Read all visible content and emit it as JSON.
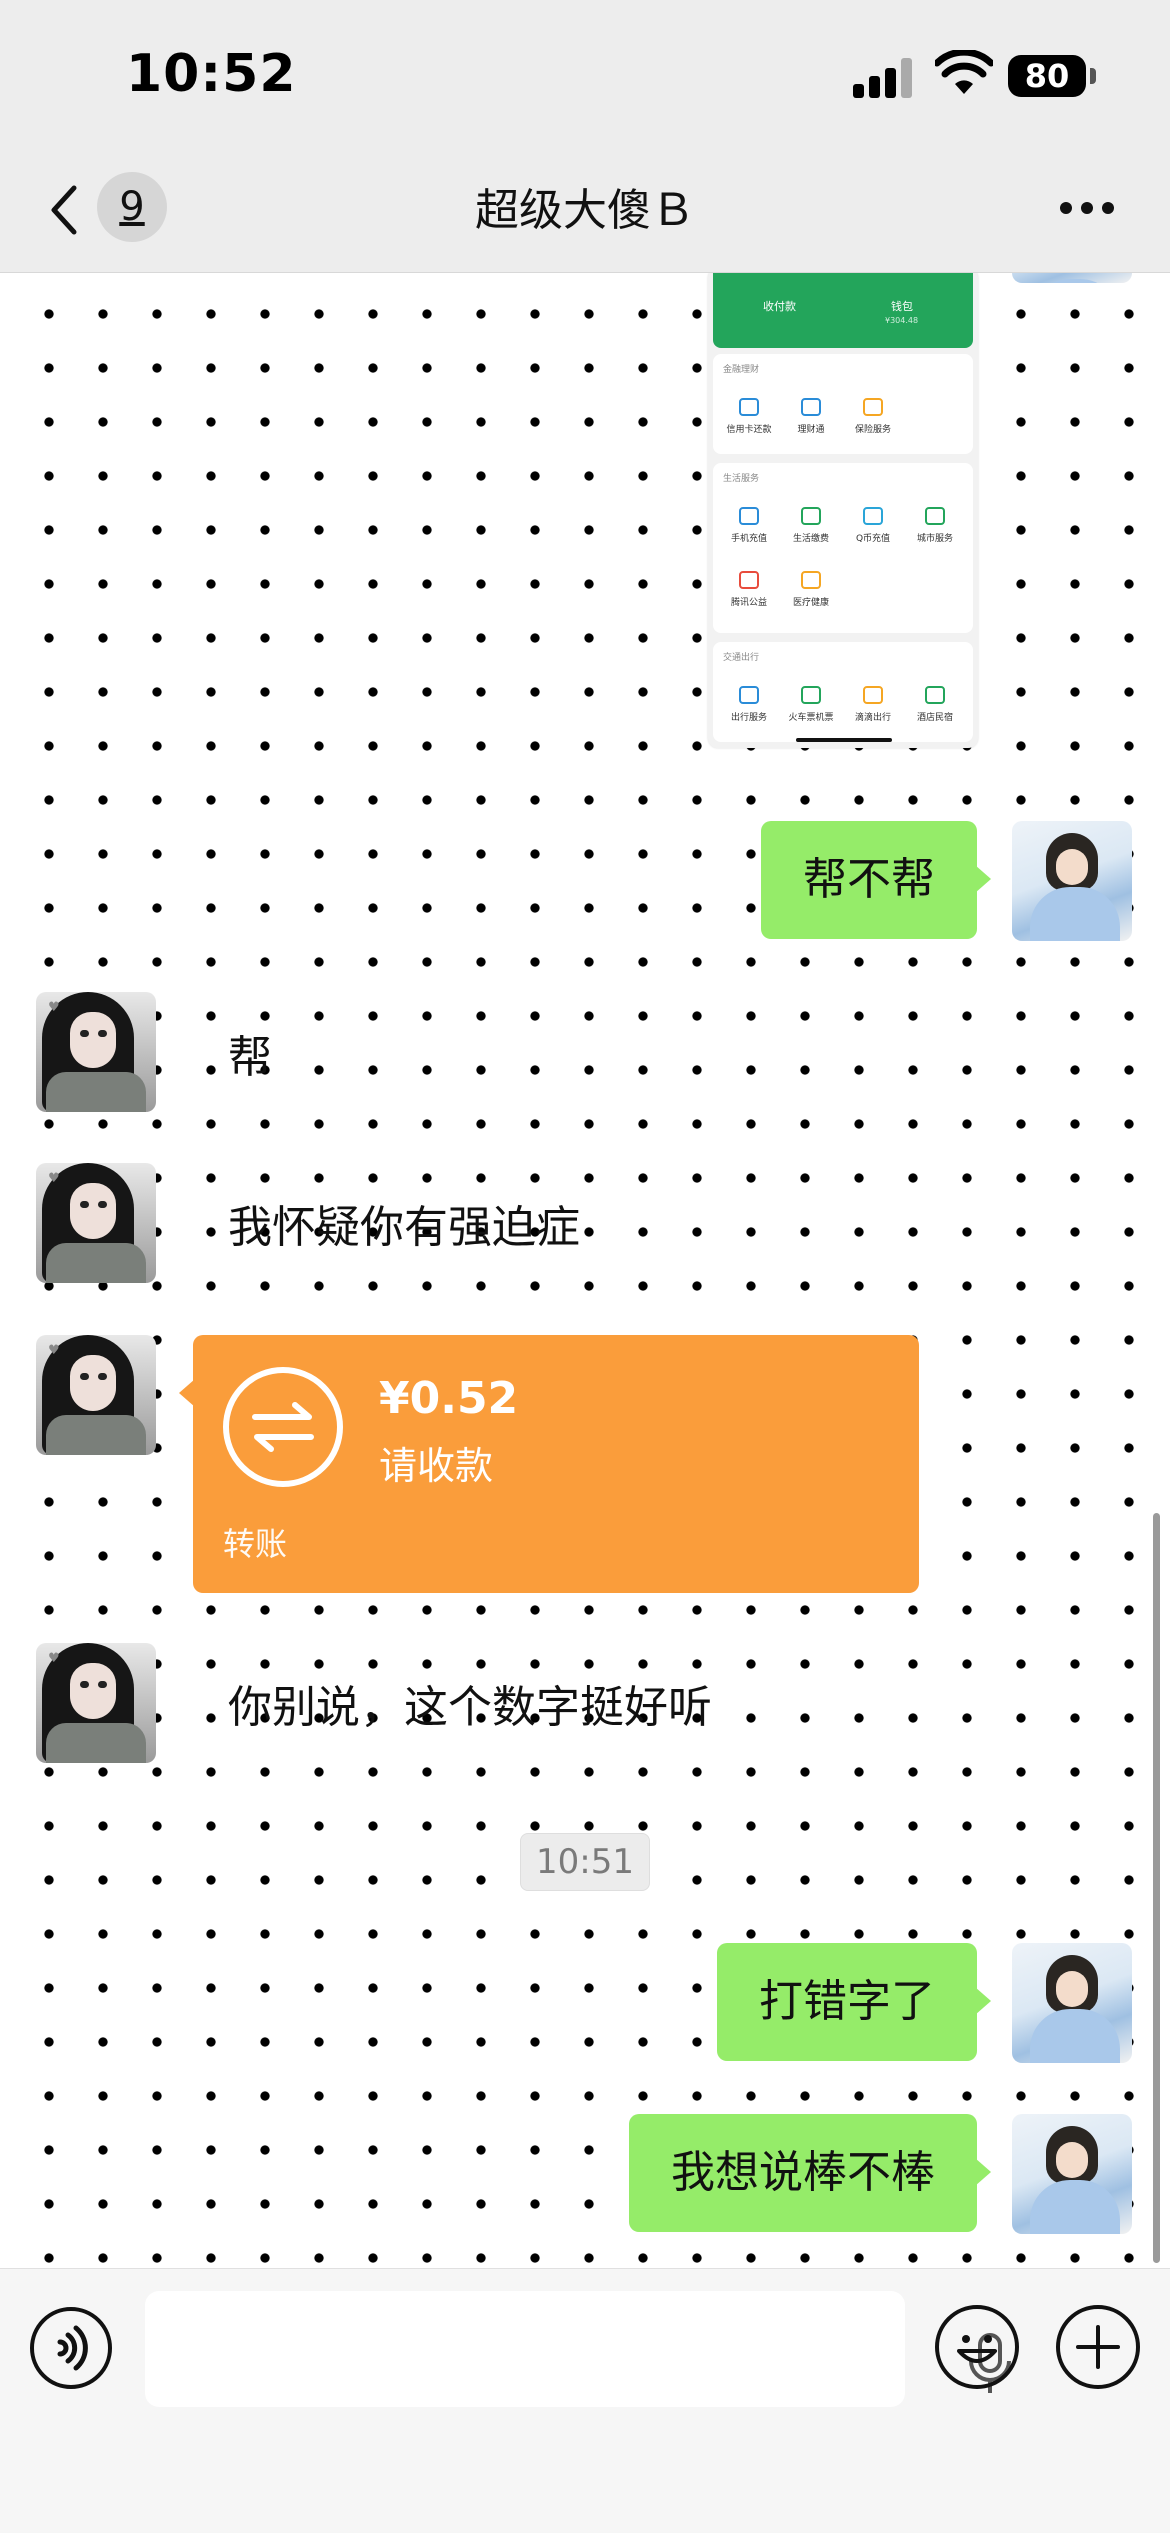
{
  "status_bar": {
    "time": "10:52",
    "battery": "80"
  },
  "nav": {
    "unread_count": "9",
    "title": "超级大傻Ｂ",
    "back_icon": "chevron-left-icon",
    "more_icon": "more-dots-icon"
  },
  "shared_screenshot": {
    "wallet_top": [
      {
        "label": "收付款",
        "sub": ""
      },
      {
        "label": "钱包",
        "sub": "¥304.48"
      }
    ],
    "sections": [
      {
        "header": "金融理财",
        "items": [
          "信用卡还款",
          "理财通",
          "保险服务"
        ]
      },
      {
        "header": "生活服务",
        "items": [
          "手机充值",
          "生活缴费",
          "Q币充值",
          "城市服务",
          "腾讯公益",
          "医疗健康"
        ]
      },
      {
        "header": "交通出行",
        "items": [
          "出行服务",
          "火车票机票",
          "滴滴出行",
          "酒店民宿"
        ]
      }
    ]
  },
  "messages": [
    {
      "side": "me",
      "text": "帮不帮"
    },
    {
      "side": "her",
      "text": "帮"
    },
    {
      "side": "her",
      "text": "我怀疑你有强迫症"
    },
    {
      "side": "her",
      "type": "transfer",
      "amount": "¥0.52",
      "status": "请收款",
      "label": "转账"
    },
    {
      "side": "her",
      "text": "你别说，这个数字挺好听"
    },
    {
      "type": "time",
      "text": "10:51"
    },
    {
      "side": "me",
      "text": "打错字了"
    },
    {
      "side": "me",
      "text": "我想说棒不棒"
    }
  ],
  "input_bar": {
    "placeholder": "",
    "voice_icon": "voice-icon",
    "mic_icon": "mic-icon",
    "emoji_icon": "emoji-icon",
    "plus_icon": "plus-icon"
  },
  "colors": {
    "my_bubble": "#95ec69",
    "transfer": "#fa9d3b",
    "wallet_green": "#23a55b",
    "bar_bg": "#ededed"
  }
}
